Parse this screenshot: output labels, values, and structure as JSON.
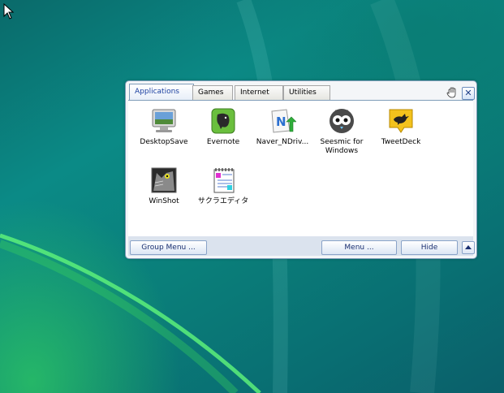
{
  "launcher": {
    "tabs": [
      {
        "label": "Applications",
        "active": true
      },
      {
        "label": "Games",
        "active": false
      },
      {
        "label": "Internet",
        "active": false
      },
      {
        "label": "Utilities",
        "active": false
      }
    ],
    "apps": [
      {
        "label": "DesktopSave",
        "icon": "desktop-monitor-icon"
      },
      {
        "label": "Evernote",
        "icon": "evernote-elephant-icon"
      },
      {
        "label": "Naver_NDriv...",
        "icon": "naver-ndrive-icon"
      },
      {
        "label": "Seesmic for Windows",
        "icon": "seesmic-owl-icon"
      },
      {
        "label": "TweetDeck",
        "icon": "tweetdeck-bird-icon"
      },
      {
        "label": "WinShot",
        "icon": "winshot-cat-icon"
      },
      {
        "label": "サクラエディタ",
        "icon": "sakura-editor-notepad-icon"
      }
    ],
    "footer": {
      "group_menu_label": "Group Menu ...",
      "menu_label": "Menu ...",
      "hide_label": "Hide"
    }
  },
  "colors": {
    "accent": "#1a3fa0",
    "border": "#7f9db9",
    "footer_bg": "#dbe3ee"
  }
}
